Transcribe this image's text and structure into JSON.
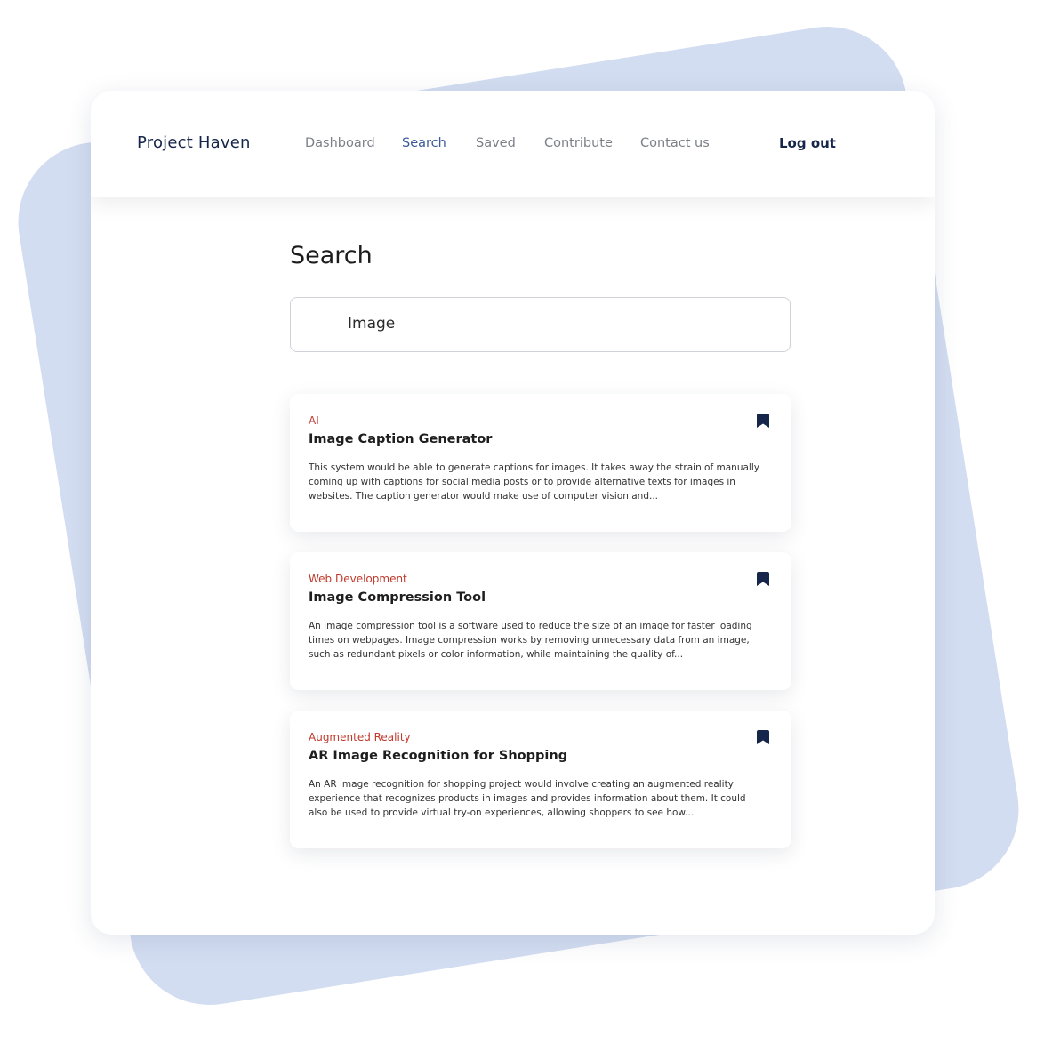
{
  "nav": {
    "brand": "Project Haven",
    "links": [
      {
        "label": "Dashboard",
        "active": false
      },
      {
        "label": "Search",
        "active": true
      },
      {
        "label": "Saved",
        "active": false
      },
      {
        "label": "Contribute",
        "active": false
      },
      {
        "label": "Contact us",
        "active": false
      }
    ],
    "logout": "Log out"
  },
  "page": {
    "title": "Search"
  },
  "search": {
    "value": "Image"
  },
  "results": [
    {
      "category": "AI",
      "title": "Image Caption Generator",
      "description": "This system would be able to generate captions for images. It takes away the strain of manually coming up with captions for social media posts or to provide alternative texts for images in websites. The caption generator would make use of computer vision and...",
      "icon": "bookmark-icon"
    },
    {
      "category": "Web Development",
      "title": "Image Compression Tool",
      "description": "An image compression tool is a software used to reduce the size of an image for faster loading times on webpages. Image compression works by removing unnecessary data from an image, such as redundant pixels or color information, while maintaining the quality of...",
      "icon": "bookmark-icon"
    },
    {
      "category": "Augmented Reality",
      "title": "AR Image Recognition for Shopping",
      "description": "An AR image recognition for shopping project would involve creating an augmented reality experience that recognizes products in images and provides information about them. It could also be used to provide virtual try-on experiences, allowing shoppers to see how...",
      "icon": "bookmark-icon"
    }
  ],
  "colors": {
    "brand": "#16264a",
    "active_link": "#3c5a9a",
    "category": "#c0392b",
    "background_shape": "#d3ddf1"
  }
}
